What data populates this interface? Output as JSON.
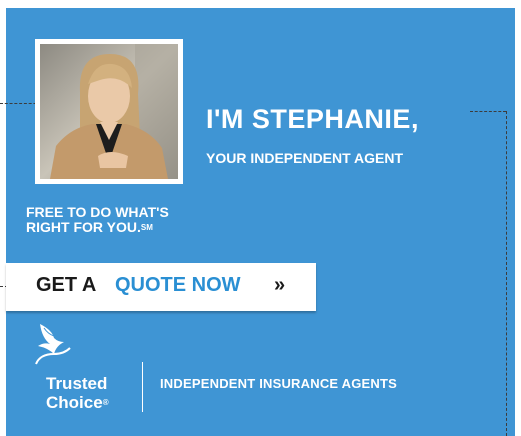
{
  "ad": {
    "headline": "I'M STEPHANIE,",
    "subhead": "YOUR INDEPENDENT AGENT",
    "tagline_line1": "FREE TO DO WHAT'S",
    "tagline_line2": "RIGHT FOR YOU.",
    "tagline_mark": "SM",
    "cta": {
      "part1": "GET A ",
      "part2": "QUOTE NOW",
      "part3": " »"
    },
    "logo": {
      "line1": "Trusted",
      "line2": "Choice",
      "mark": "®"
    },
    "footer": "INDEPENDENT INSURANCE AGENTS",
    "colors": {
      "background": "#3f95d4",
      "accent": "#2a8fd3",
      "text": "#ffffff"
    },
    "icons": {
      "logo": "eagle-logo-icon",
      "photo": "agent-photo"
    }
  }
}
